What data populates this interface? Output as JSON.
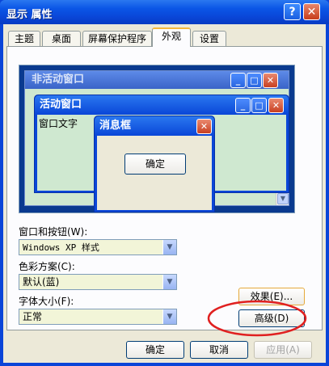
{
  "window": {
    "title": "显示 属性",
    "help_glyph": "?",
    "close_glyph": "✕"
  },
  "tabs": [
    {
      "label": "主题"
    },
    {
      "label": "桌面"
    },
    {
      "label": "屏幕保护程序"
    },
    {
      "label": "外观",
      "active": true
    },
    {
      "label": "设置"
    }
  ],
  "preview": {
    "inactive_title": "非活动窗口",
    "active_title": "活动窗口",
    "window_text": "窗口文字",
    "msgbox_title": "消息框",
    "ok_label": "确定"
  },
  "fields": {
    "windows_buttons_label": "窗口和按钮(W):",
    "windows_buttons_value": "Windows XP 样式",
    "color_scheme_label": "色彩方案(C):",
    "color_scheme_value": "默认(蓝)",
    "font_size_label": "字体大小(F):",
    "font_size_value": "正常"
  },
  "buttons": {
    "effects": "效果(E)...",
    "advanced": "高级(D)",
    "ok": "确定",
    "cancel": "取消",
    "apply": "应用(A)"
  },
  "colors": {
    "highlight_circle": "#e02020",
    "xp_blue": "#0a46d8",
    "face": "#ece9d8",
    "preview_window_bg": "#cfe8d0"
  }
}
